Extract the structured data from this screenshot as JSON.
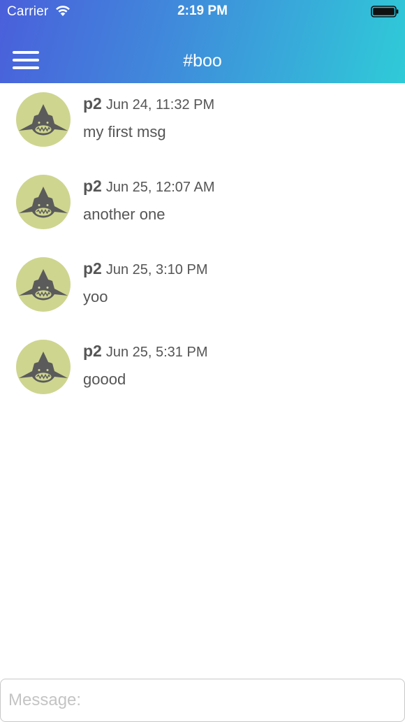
{
  "status_bar": {
    "carrier": "Carrier",
    "time": "2:19 PM",
    "icons": [
      "wifi-icon",
      "battery-icon"
    ]
  },
  "nav": {
    "title": "#boo",
    "menu_icon": "hamburger-menu-icon"
  },
  "colors": {
    "header_gradient": [
      "#4a5fdb",
      "#3f8ddb",
      "#2fcbd8"
    ],
    "avatar_bg": "#ced58f",
    "avatar_shark": "#5b5b5b",
    "text": "#555555",
    "placeholder": "#c4c4c4"
  },
  "messages": [
    {
      "author": "p2",
      "time": "Jun 24, 11:32 PM",
      "text": "my first msg",
      "avatar_icon": "shark-avatar-icon"
    },
    {
      "author": "p2",
      "time": "Jun 25, 12:07 AM",
      "text": "another one",
      "avatar_icon": "shark-avatar-icon"
    },
    {
      "author": "p2",
      "time": "Jun 25, 3:10 PM",
      "text": "yoo",
      "avatar_icon": "shark-avatar-icon"
    },
    {
      "author": "p2",
      "time": "Jun 25, 5:31 PM",
      "text": "goood",
      "avatar_icon": "shark-avatar-icon"
    }
  ],
  "composer": {
    "placeholder": "Message:",
    "value": ""
  }
}
